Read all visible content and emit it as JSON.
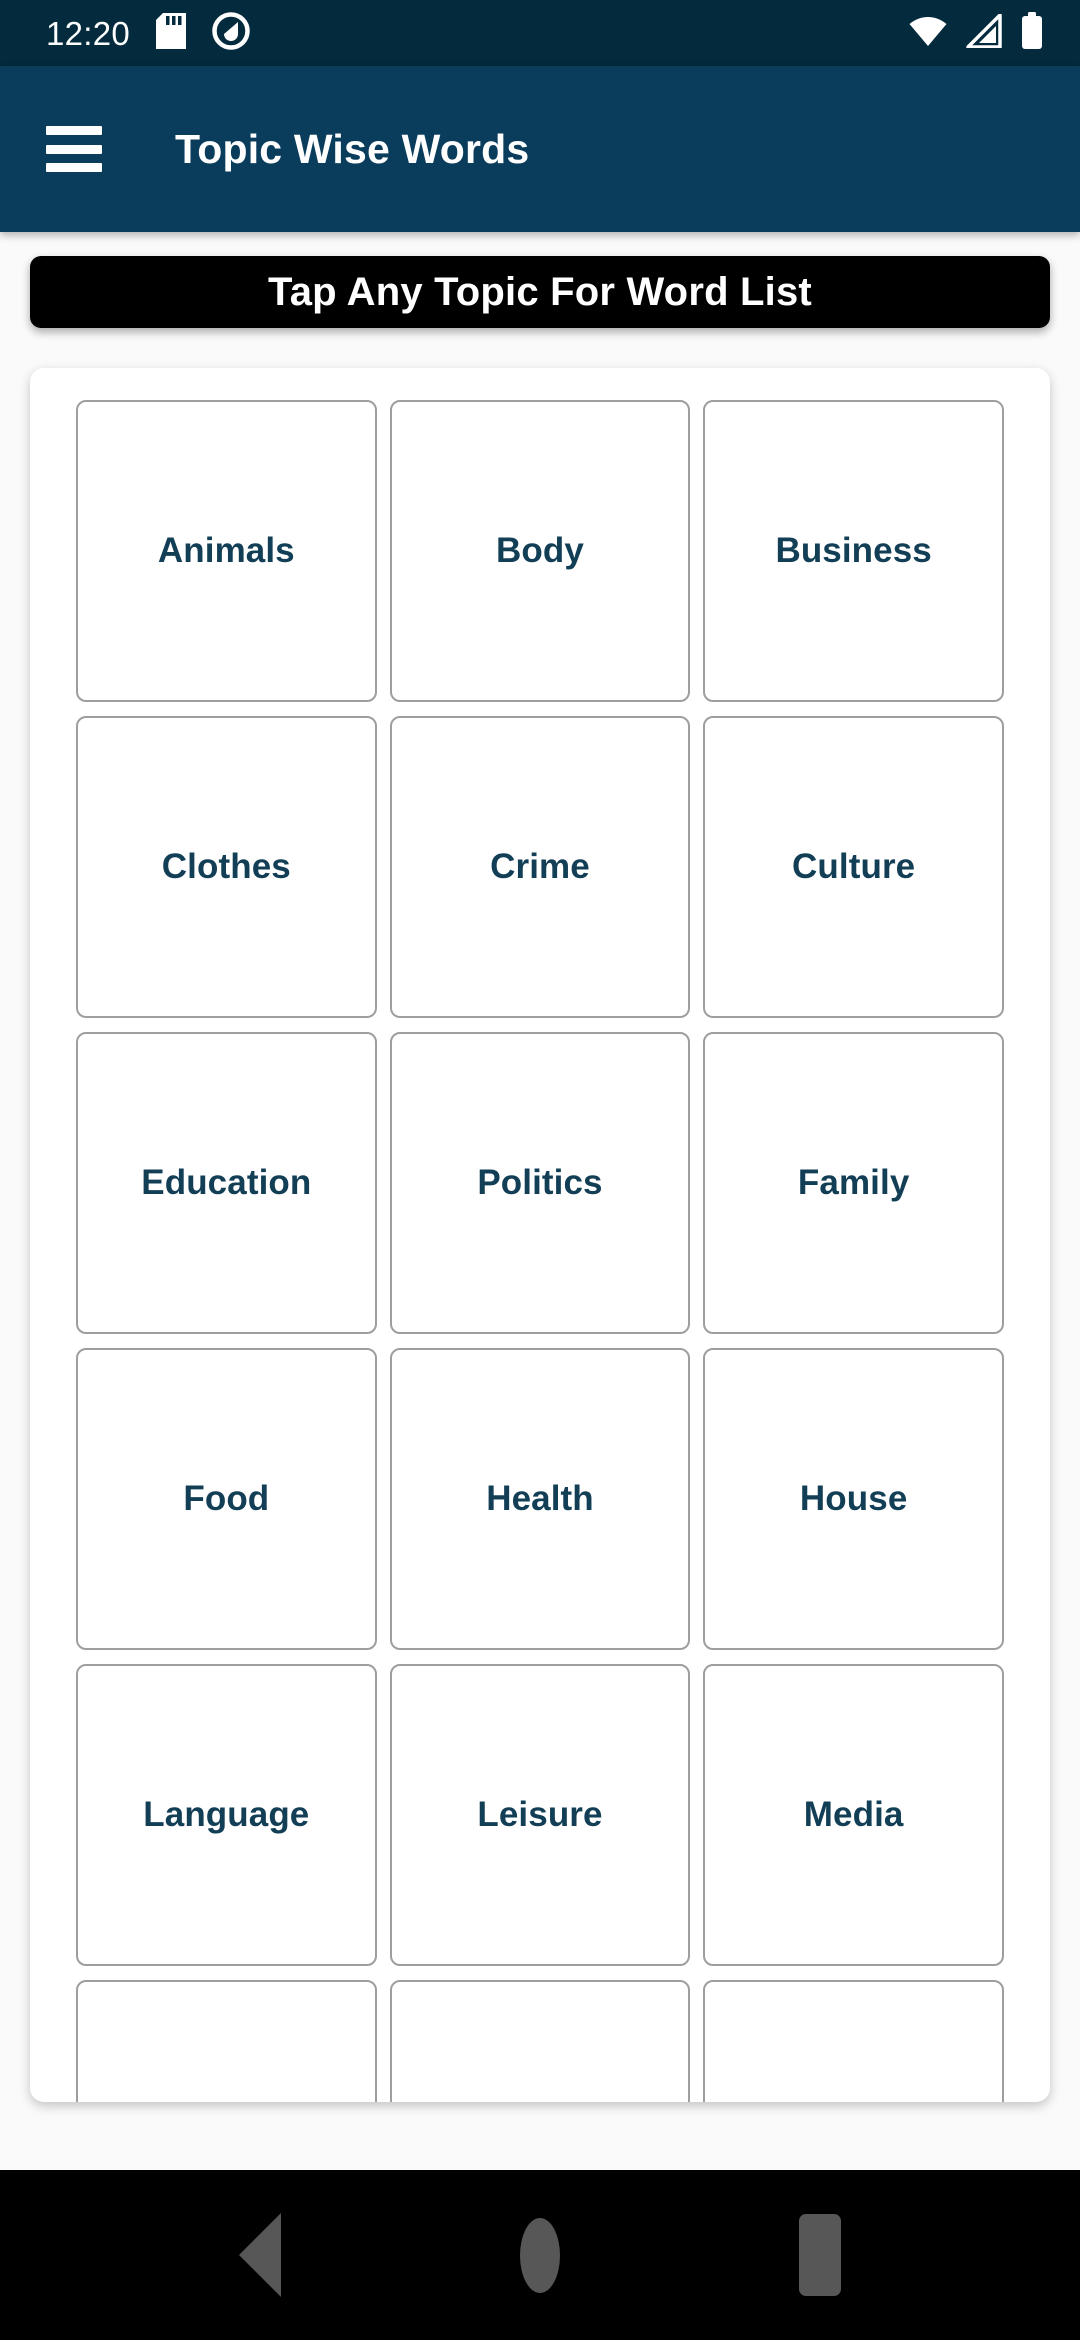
{
  "status_bar": {
    "time": "12:20",
    "icons_left": [
      "sd-card-icon",
      "do-not-disturb-icon"
    ],
    "icons_right": [
      "wifi-icon",
      "cellular-signal-icon",
      "battery-icon"
    ],
    "background_color": "#042A3D",
    "foreground_color": "#FFFFFF"
  },
  "app_bar": {
    "menu_icon": "hamburger-menu-icon",
    "title": "Topic Wise Words",
    "background_color": "#0A3C5C",
    "title_color": "#FFFFFF"
  },
  "banner": {
    "text": "Tap Any Topic For Word List",
    "background_color": "#000000",
    "text_color": "#FFFFFF"
  },
  "topic_grid": {
    "columns": 3,
    "cell_text_color": "#123E56",
    "cell_border_color": "#9E9E9E",
    "cells": [
      {
        "label": "Animals"
      },
      {
        "label": "Body"
      },
      {
        "label": "Business"
      },
      {
        "label": "Clothes"
      },
      {
        "label": "Crime"
      },
      {
        "label": "Culture"
      },
      {
        "label": "Education"
      },
      {
        "label": "Politics"
      },
      {
        "label": "Family"
      },
      {
        "label": "Food"
      },
      {
        "label": "Health"
      },
      {
        "label": "House"
      },
      {
        "label": "Language"
      },
      {
        "label": "Leisure"
      },
      {
        "label": "Media"
      },
      {
        "label": ""
      },
      {
        "label": ""
      },
      {
        "label": ""
      }
    ]
  },
  "nav_bar": {
    "background_color": "#000000",
    "icon_color": "#575757",
    "buttons": [
      {
        "name": "back-button",
        "icon": "triangle-left-icon"
      },
      {
        "name": "home-button",
        "icon": "circle-icon"
      },
      {
        "name": "recents-button",
        "icon": "square-icon"
      }
    ]
  }
}
